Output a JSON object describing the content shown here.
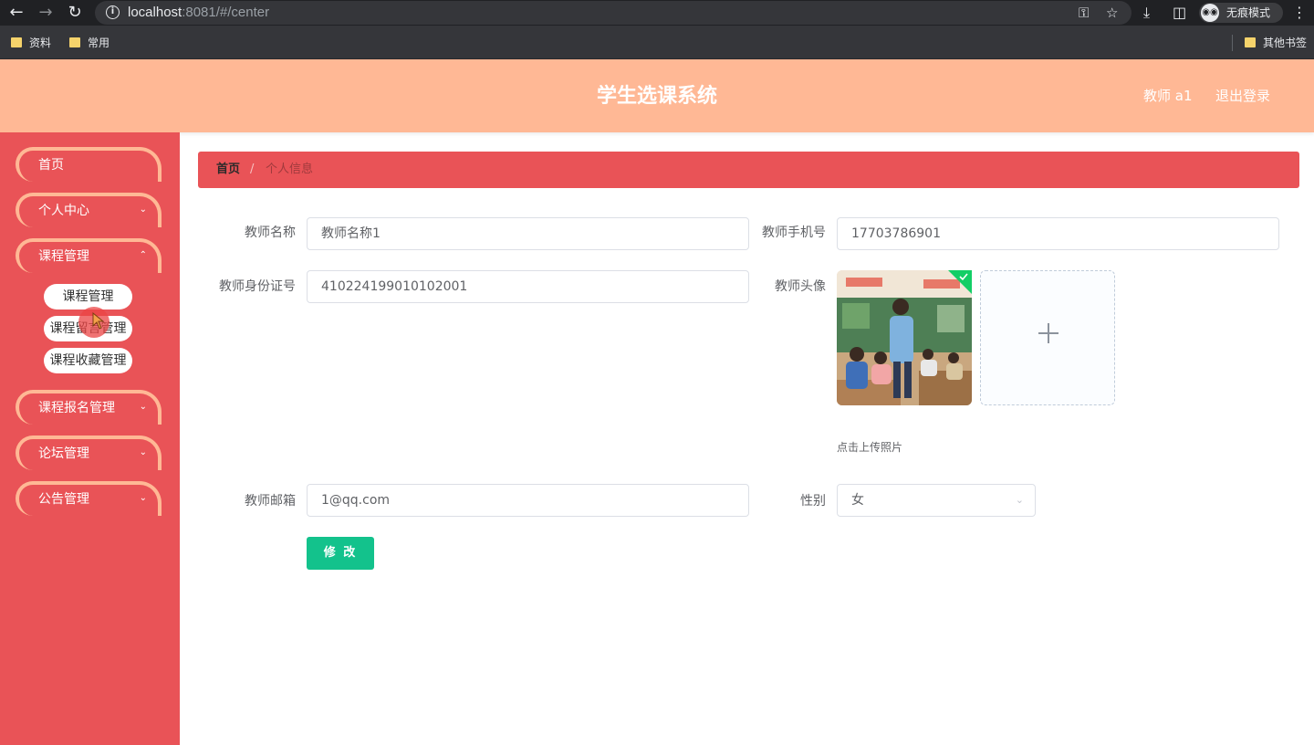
{
  "browser": {
    "url_host": "localhost",
    "url_rest": ":8081/#/center",
    "incognito_label": "无痕模式",
    "bookmarks": [
      "资料",
      "常用"
    ],
    "other_bookmarks": "其他书签"
  },
  "header": {
    "title": "学生选课系统",
    "user": "教师 a1",
    "logout": "退出登录"
  },
  "sidebar": {
    "items": [
      {
        "label": "首页"
      },
      {
        "label": "个人中心"
      },
      {
        "label": "课程管理"
      },
      {
        "label": "课程报名管理"
      },
      {
        "label": "论坛管理"
      },
      {
        "label": "公告管理"
      }
    ],
    "submenu": [
      "课程管理",
      "课程留言管理",
      "课程收藏管理"
    ]
  },
  "breadcrumb": {
    "home": "首页",
    "separator": "/",
    "current": "个人信息"
  },
  "form": {
    "teacher_name_label": "教师名称",
    "teacher_name_value": "教师名称1",
    "teacher_phone_label": "教师手机号",
    "teacher_phone_value": "17703786901",
    "teacher_id_label": "教师身份证号",
    "teacher_id_value": "410224199010102001",
    "avatar_label": "教师头像",
    "upload_tip": "点击上传照片",
    "email_label": "教师邮箱",
    "email_value": "1@qq.com",
    "gender_label": "性别",
    "gender_value": "女",
    "submit_label": "修 改"
  },
  "colors": {
    "header_bg": "#ffb895",
    "sidebar_bg": "#e95357",
    "accent_green": "#13c28c"
  }
}
